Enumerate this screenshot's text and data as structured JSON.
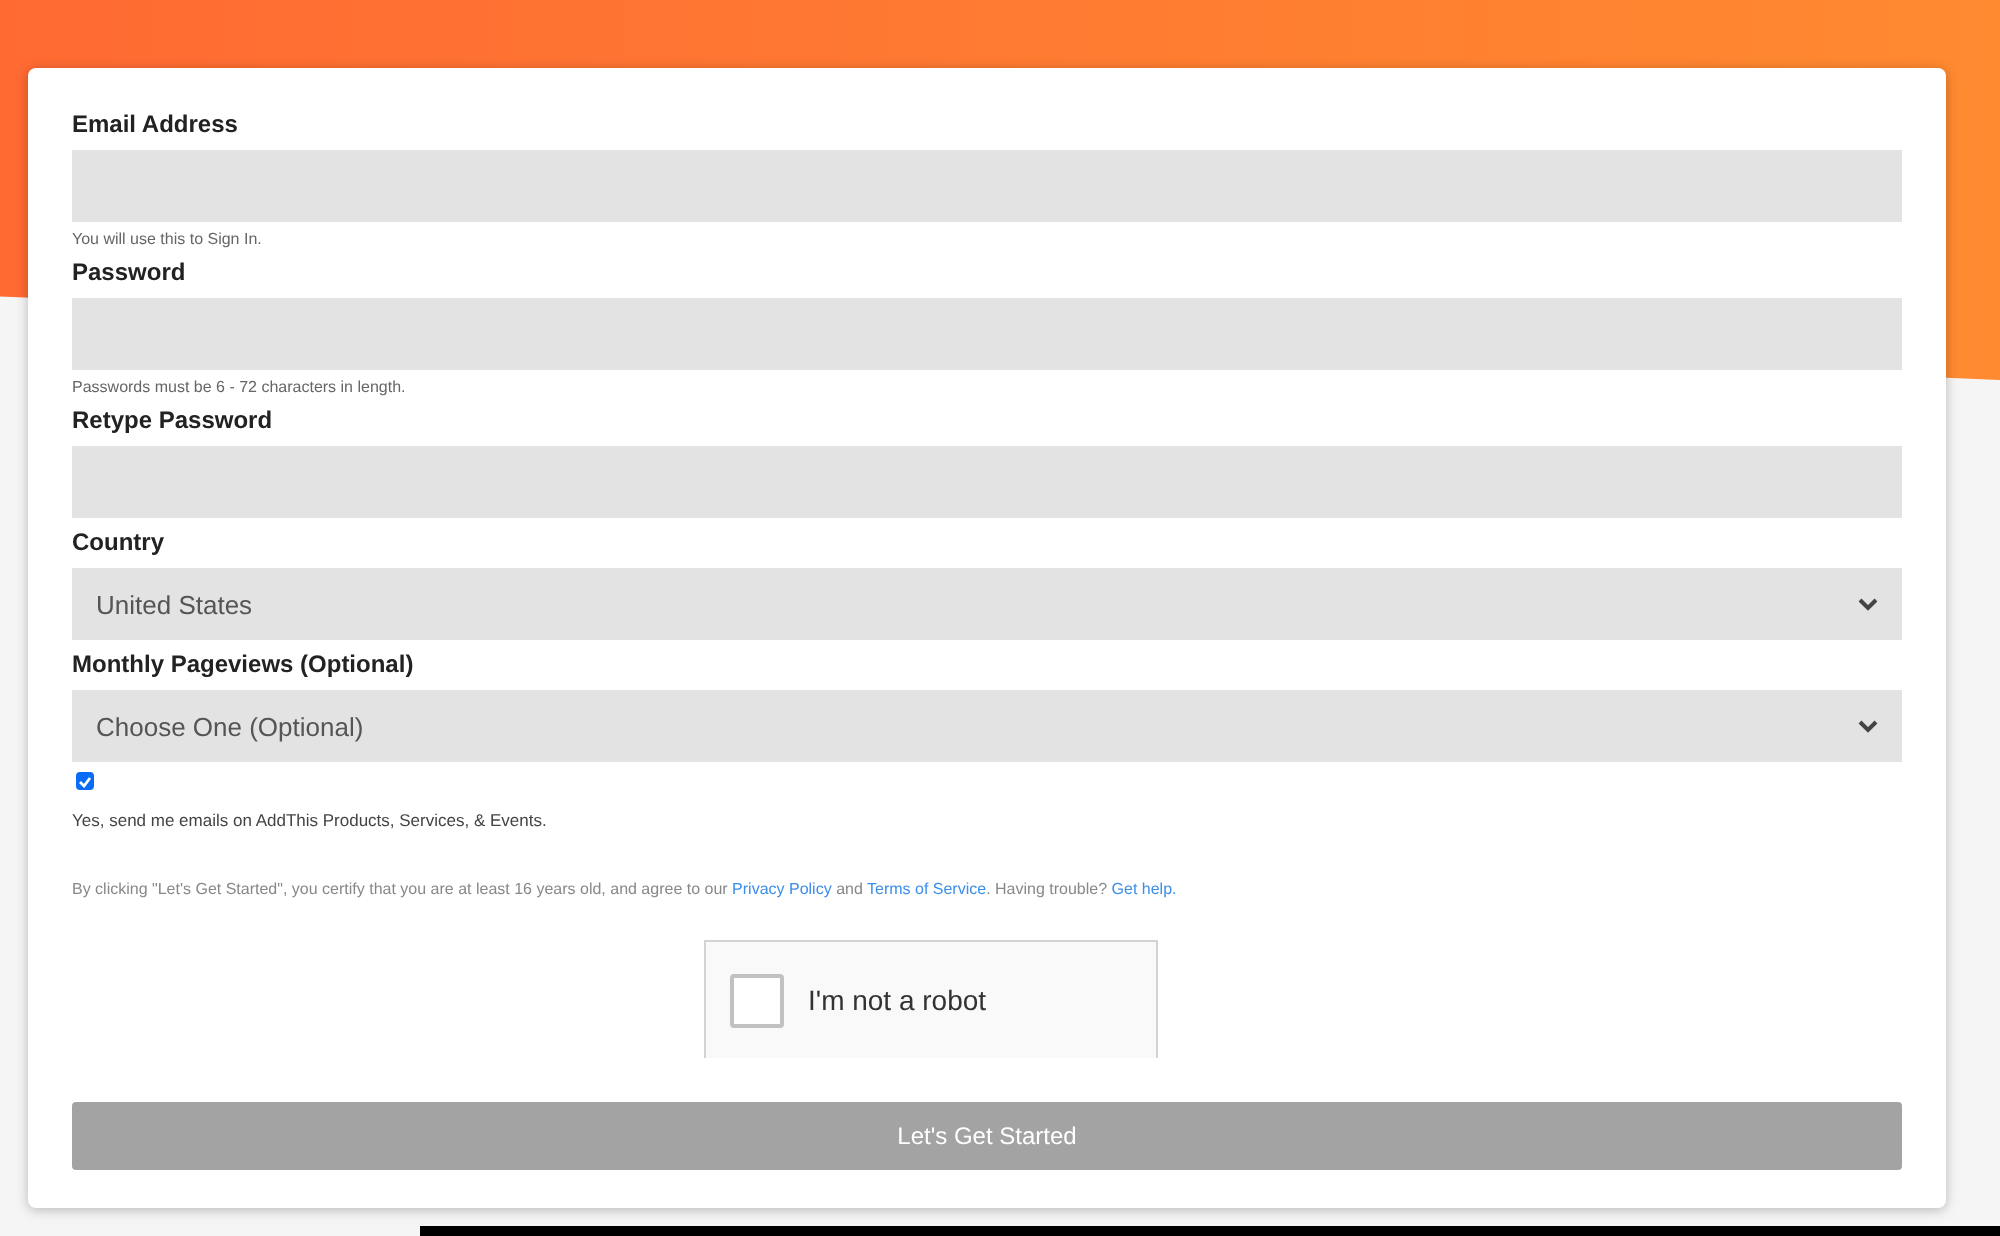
{
  "fields": [
    {
      "kind": "text",
      "label": "Email Address",
      "hint": "You will use this to Sign In."
    },
    {
      "kind": "password",
      "label": "Password",
      "hint": "Passwords must be 6 - 72 characters in length."
    },
    {
      "kind": "password",
      "label": "Retype Password"
    },
    {
      "kind": "select",
      "label": "Country",
      "value": "United States"
    },
    {
      "kind": "select",
      "label": "Monthly Pageviews (Optional)",
      "value": "Choose One (Optional)"
    }
  ],
  "newsletter": {
    "checked": true,
    "label": "Yes, send me emails on AddThis Products, Services, & Events."
  },
  "consent": {
    "parts": [
      {
        "kind": "text",
        "text": "By clicking \"Let's Get Started\", you certify that you are at least 16 years old, and agree to our "
      },
      {
        "kind": "link",
        "text": "Privacy Policy"
      },
      {
        "kind": "text",
        "text": " and "
      },
      {
        "kind": "link",
        "text": "Terms of Service"
      },
      {
        "kind": "text",
        "text": ". Having trouble? "
      },
      {
        "kind": "link",
        "text": "Get help."
      }
    ]
  },
  "captcha": {
    "checked": false,
    "label": "I'm not a robot"
  },
  "submit": {
    "label": "Let's Get Started"
  }
}
